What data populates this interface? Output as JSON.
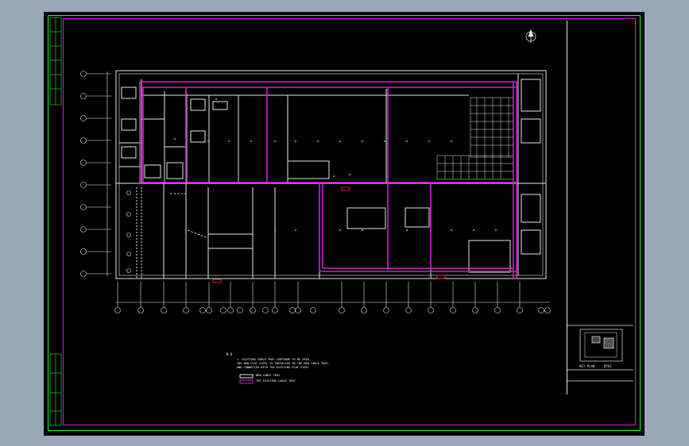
{
  "drawing": {
    "note_title": "N O",
    "notes": [
      "1. EXISTING CABLE TRAY CONTINUE TO BE USED",
      "THE NEW FLAT STEEL IS INSTALLED IN THE NEW CABLE TRAY,",
      "AND CONNECTED WITH THE EXISTING FLAT STEEL"
    ],
    "legend": [
      {
        "label": "NEW CABLE TRAY",
        "color": "#ffffff"
      },
      {
        "label": "THE EXISTING CABLE TRAY",
        "color": "#d81bd8"
      }
    ],
    "sheet_title": "KEY PLAN",
    "sheet_code": "KP01",
    "north_symbol": "north-arrow-icon",
    "colors": {
      "background": "#000000",
      "drawing_line": "#e6e6e6",
      "existing_tray": "#d81bd8",
      "frame_green": "#22ff33",
      "marker_red": "#ff2b2b",
      "marker_green": "#22ff33"
    }
  }
}
